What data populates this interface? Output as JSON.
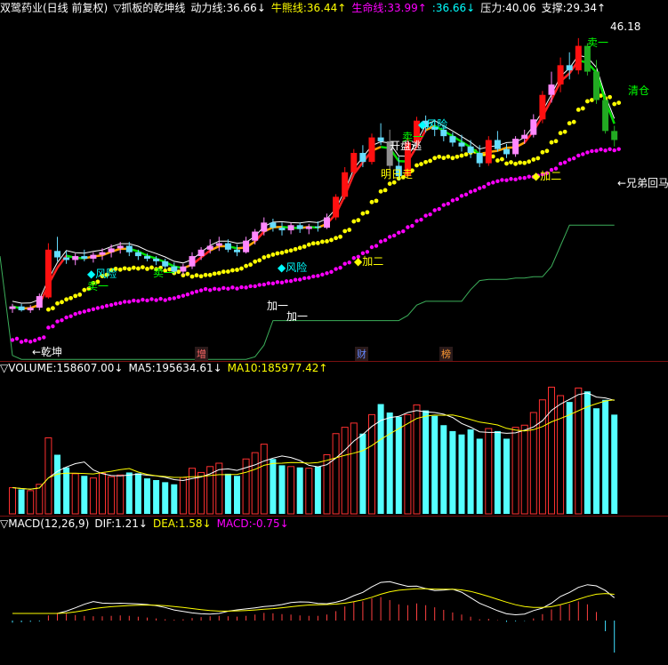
{
  "price_header": {
    "title": "双鹭药业(日线 前复权)",
    "indicator": "▽抓板的乾坤线",
    "items": [
      {
        "label": "动力线:",
        "value": "36.66",
        "arrow": "↓",
        "color": "#ffffff"
      },
      {
        "label": "牛熊线:",
        "value": "36.44",
        "arrow": "↑",
        "color": "#ffff00"
      },
      {
        "label": "生命线:",
        "value": "33.99",
        "arrow": "↑",
        "color": "#ff00ff"
      },
      {
        "label": ":",
        "value": "36.66",
        "arrow": "↓",
        "color": "#00ffff"
      },
      {
        "label": "压力:",
        "value": "40.06",
        "arrow": "",
        "color": "#ffffff"
      },
      {
        "label": "支撑:",
        "value": "29.34",
        "arrow": "↑",
        "color": "#ffffff"
      }
    ]
  },
  "price_annotations": [
    {
      "text": "◆风险",
      "color": "#00ffff"
    },
    {
      "text": "卖一",
      "color": "#00ff00"
    },
    {
      "text": "卖一",
      "color": "#00ff00"
    },
    {
      "text": "◆风险",
      "color": "#00ffff"
    },
    {
      "text": "加一",
      "color": "#ffffff"
    },
    {
      "text": "加一",
      "color": "#ffffff"
    },
    {
      "text": "◆加二",
      "color": "#ffff00"
    },
    {
      "text": "明日走",
      "color": "#ffff00"
    },
    {
      "text": "开盘逃",
      "color": "#ffffff"
    },
    {
      "text": "卖一",
      "color": "#00ff00"
    },
    {
      "text": "◆风险",
      "color": "#00ffff"
    },
    {
      "text": "◆加二",
      "color": "#ffff00"
    },
    {
      "text": "卖一",
      "color": "#00ff00"
    },
    {
      "text": "清仓",
      "color": "#00ff00"
    },
    {
      "text": "←兄弟回马",
      "color": "#ffffff"
    },
    {
      "text": "←乾坤",
      "color": "#ffffff"
    },
    {
      "text": "46.18",
      "color": "#ffffff"
    }
  ],
  "markers": [
    {
      "text": "增",
      "color": "#ff6666"
    },
    {
      "text": "财",
      "color": "#6688ff"
    },
    {
      "text": "榜",
      "color": "#ff9933"
    }
  ],
  "volume_header": {
    "label": "▽VOLUME:",
    "value": "158607.00",
    "arrow": "↓",
    "ma5_label": "MA5:",
    "ma5": "195634.61",
    "ma5_arrow": "↓",
    "ma10_label": "MA10:",
    "ma10": "185977.42",
    "ma10_arrow": "↑"
  },
  "macd_header": {
    "label": "▽MACD(12,26,9)",
    "dif_label": "DIF:",
    "dif": "1.21",
    "dif_arrow": "↓",
    "dea_label": "DEA:",
    "dea": "1.58",
    "dea_arrow": "↓",
    "macd_label": "MACD:",
    "macd": "-0.75",
    "macd_arrow": "↓"
  },
  "chart_data": {
    "type": "candlestick",
    "candles": [
      [
        25.2,
        25.6,
        24.9,
        25.4
      ],
      [
        25.4,
        25.6,
        25.0,
        25.1
      ],
      [
        25.1,
        25.5,
        24.9,
        25.3
      ],
      [
        25.3,
        26.4,
        25.1,
        26.2
      ],
      [
        26.1,
        30.3,
        26.0,
        29.8
      ],
      [
        29.7,
        30.8,
        28.9,
        29.2
      ],
      [
        29.2,
        29.7,
        28.7,
        29.0
      ],
      [
        29.0,
        29.5,
        28.6,
        29.3
      ],
      [
        29.3,
        29.8,
        28.9,
        29.1
      ],
      [
        29.1,
        29.6,
        28.8,
        29.4
      ],
      [
        29.4,
        29.9,
        29.0,
        29.6
      ],
      [
        29.6,
        30.2,
        29.2,
        29.9
      ],
      [
        29.9,
        30.4,
        29.5,
        30.1
      ],
      [
        30.1,
        30.4,
        29.3,
        29.6
      ],
      [
        29.6,
        29.8,
        29.0,
        29.3
      ],
      [
        29.3,
        29.5,
        28.9,
        29.1
      ],
      [
        29.1,
        29.3,
        28.6,
        28.9
      ],
      [
        28.9,
        29.1,
        28.3,
        28.5
      ],
      [
        28.5,
        28.8,
        27.9,
        28.1
      ],
      [
        28.1,
        28.7,
        27.8,
        28.5
      ],
      [
        28.5,
        29.6,
        28.3,
        29.3
      ],
      [
        29.3,
        30.0,
        29.0,
        29.8
      ],
      [
        29.8,
        30.6,
        29.5,
        30.1
      ],
      [
        30.1,
        30.8,
        29.7,
        30.3
      ],
      [
        30.3,
        30.6,
        29.6,
        29.8
      ],
      [
        29.8,
        30.2,
        29.3,
        29.6
      ],
      [
        29.6,
        30.8,
        29.5,
        30.5
      ],
      [
        30.5,
        31.4,
        30.2,
        31.2
      ],
      [
        31.2,
        32.3,
        30.9,
        31.9
      ],
      [
        31.9,
        32.2,
        31.2,
        31.5
      ],
      [
        31.5,
        31.9,
        30.9,
        31.3
      ],
      [
        31.3,
        31.9,
        31.0,
        31.7
      ],
      [
        31.7,
        31.9,
        31.1,
        31.4
      ],
      [
        31.4,
        31.8,
        31.0,
        31.6
      ],
      [
        31.6,
        32.0,
        31.2,
        31.5
      ],
      [
        31.5,
        32.6,
        31.4,
        32.3
      ],
      [
        32.3,
        34.1,
        32.1,
        33.9
      ],
      [
        33.9,
        36.2,
        33.7,
        35.8
      ],
      [
        35.8,
        37.6,
        35.5,
        37.3
      ],
      [
        37.3,
        37.9,
        36.2,
        36.6
      ],
      [
        36.6,
        38.8,
        36.4,
        38.5
      ],
      [
        38.5,
        39.6,
        37.9,
        38.2
      ],
      [
        38.2,
        39.1,
        36.0,
        36.3
      ],
      [
        36.3,
        37.0,
        35.2,
        35.5
      ],
      [
        35.5,
        38.5,
        35.4,
        38.1
      ],
      [
        38.1,
        40.1,
        37.8,
        39.8
      ],
      [
        39.8,
        40.2,
        38.9,
        39.3
      ],
      [
        39.3,
        39.9,
        38.6,
        39.1
      ],
      [
        39.1,
        39.4,
        38.2,
        38.6
      ],
      [
        38.6,
        38.9,
        37.8,
        38.1
      ],
      [
        38.1,
        38.7,
        37.4,
        37.8
      ],
      [
        37.8,
        38.3,
        36.9,
        37.3
      ],
      [
        37.3,
        37.9,
        36.2,
        36.5
      ],
      [
        36.5,
        38.6,
        36.3,
        38.3
      ],
      [
        38.3,
        39.0,
        37.4,
        37.6
      ],
      [
        37.6,
        38.0,
        36.9,
        37.2
      ],
      [
        37.2,
        38.6,
        37.0,
        38.4
      ],
      [
        38.4,
        39.1,
        38.0,
        38.7
      ],
      [
        38.7,
        40.3,
        38.5,
        39.9
      ],
      [
        39.9,
        42.1,
        39.6,
        41.8
      ],
      [
        41.8,
        43.6,
        41.2,
        42.6
      ],
      [
        42.6,
        44.7,
        42.0,
        44.1
      ],
      [
        44.1,
        45.1,
        43.0,
        43.7
      ],
      [
        43.7,
        46.2,
        43.4,
        45.6
      ],
      [
        45.6,
        45.8,
        43.3,
        43.6
      ],
      [
        43.6,
        44.5,
        41.1,
        41.4
      ],
      [
        41.4,
        41.8,
        38.8,
        39.0
      ],
      [
        39.0,
        39.4,
        37.8,
        38.3
      ]
    ],
    "volume": [
      62,
      58,
      55,
      70,
      180,
      140,
      110,
      95,
      90,
      85,
      96,
      88,
      92,
      98,
      96,
      84,
      80,
      75,
      70,
      86,
      108,
      98,
      112,
      120,
      95,
      90,
      130,
      145,
      165,
      130,
      115,
      112,
      110,
      108,
      112,
      140,
      190,
      205,
      215,
      190,
      235,
      260,
      240,
      230,
      235,
      258,
      245,
      232,
      210,
      196,
      188,
      200,
      178,
      202,
      196,
      178,
      205,
      210,
      240,
      270,
      300,
      280,
      265,
      298,
      290,
      250,
      270,
      235
    ],
    "macd_hist": [
      -0.05,
      -0.04,
      -0.03,
      -0.02,
      0.12,
      0.18,
      0.16,
      0.13,
      0.11,
      0.1,
      0.1,
      0.11,
      0.12,
      0.11,
      0.09,
      0.07,
      0.05,
      0.03,
      0.02,
      0.03,
      0.06,
      0.08,
      0.1,
      0.11,
      0.1,
      0.09,
      0.11,
      0.14,
      0.18,
      0.17,
      0.15,
      0.14,
      0.12,
      0.11,
      0.11,
      0.14,
      0.22,
      0.33,
      0.44,
      0.45,
      0.52,
      0.55,
      0.48,
      0.38,
      0.36,
      0.4,
      0.36,
      0.31,
      0.25,
      0.19,
      0.14,
      0.09,
      0.03,
      0.04,
      0.01,
      -0.03,
      -0.02,
      -0.01,
      0.05,
      0.15,
      0.26,
      0.36,
      0.39,
      0.45,
      0.38,
      0.2,
      -0.25,
      -0.75
    ]
  }
}
